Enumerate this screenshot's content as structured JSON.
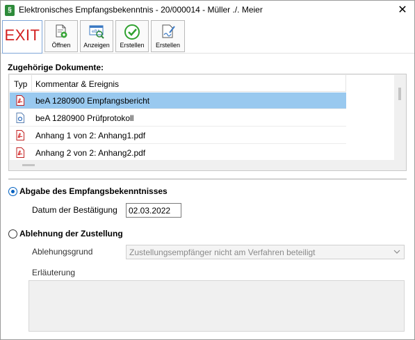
{
  "window": {
    "title": "Elektronisches Empfangsbekenntnis - 20/000014 - Müller ./. Meier",
    "app_icon_glyph": "§",
    "close_glyph": "✕"
  },
  "toolbar": {
    "exit_label": "EXIT",
    "buttons": [
      {
        "label": "Öffnen",
        "icon": "open-document-icon"
      },
      {
        "label": "Anzeigen",
        "icon": "view-document-icon"
      },
      {
        "label": "Erstellen",
        "icon": "checkmark-icon"
      },
      {
        "label": "Erstellen",
        "icon": "sign-document-icon"
      }
    ]
  },
  "documents": {
    "section_label": "Zugehörige Dokumente:",
    "columns": {
      "type": "Typ",
      "comment": "Kommentar & Ereignis"
    },
    "rows": [
      {
        "icon": "pdf-icon",
        "text": "beA 1280900 Empfangsbericht",
        "selected": true
      },
      {
        "icon": "generic-file-icon",
        "text": "beA 1280900 Prüfprotokoll",
        "selected": false
      },
      {
        "icon": "pdf-icon",
        "text": "Anhang 1 von 2: Anhang1.pdf",
        "selected": false
      },
      {
        "icon": "pdf-icon",
        "text": "Anhang 2 von 2: Anhang2.pdf",
        "selected": false
      }
    ]
  },
  "acceptance": {
    "label": "Abgabe des Empfangsbekenntnisses",
    "checked": true,
    "date_label": "Datum der Bestätigung",
    "date_value": "02.03.2022"
  },
  "rejection": {
    "label": "Ablehnung der Zustellung",
    "checked": false,
    "reason_label": "Ablehungsgrund",
    "reason_value": "Zustellungsempfänger nicht am Verfahren beteiligt",
    "explanation_label": "Erläuterung",
    "explanation_value": ""
  },
  "colors": {
    "selection": "#99c9ef",
    "exit_red": "#d32020",
    "pdf_red": "#d32020",
    "radio_blue": "#0060c0"
  }
}
